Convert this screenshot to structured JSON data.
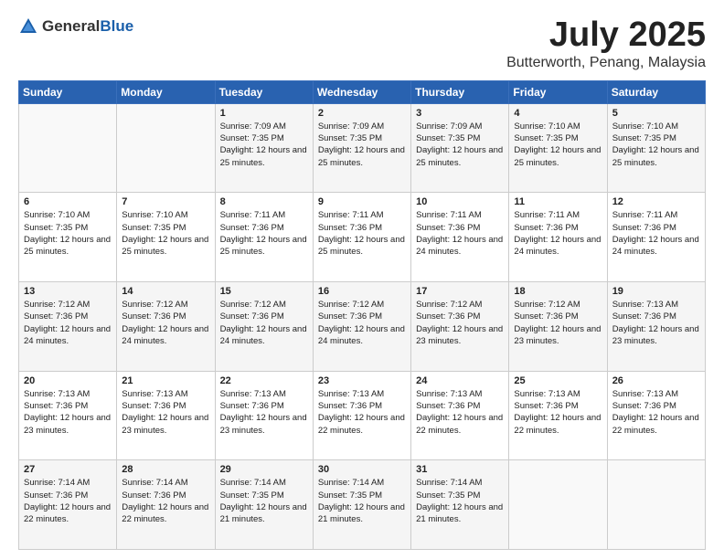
{
  "logo": {
    "general": "General",
    "blue": "Blue"
  },
  "title": {
    "month": "July 2025",
    "location": "Butterworth, Penang, Malaysia"
  },
  "weekdays": [
    "Sunday",
    "Monday",
    "Tuesday",
    "Wednesday",
    "Thursday",
    "Friday",
    "Saturday"
  ],
  "weeks": [
    [
      {
        "day": "",
        "info": ""
      },
      {
        "day": "",
        "info": ""
      },
      {
        "day": "1",
        "info": "Sunrise: 7:09 AM\nSunset: 7:35 PM\nDaylight: 12 hours and 25 minutes."
      },
      {
        "day": "2",
        "info": "Sunrise: 7:09 AM\nSunset: 7:35 PM\nDaylight: 12 hours and 25 minutes."
      },
      {
        "day": "3",
        "info": "Sunrise: 7:09 AM\nSunset: 7:35 PM\nDaylight: 12 hours and 25 minutes."
      },
      {
        "day": "4",
        "info": "Sunrise: 7:10 AM\nSunset: 7:35 PM\nDaylight: 12 hours and 25 minutes."
      },
      {
        "day": "5",
        "info": "Sunrise: 7:10 AM\nSunset: 7:35 PM\nDaylight: 12 hours and 25 minutes."
      }
    ],
    [
      {
        "day": "6",
        "info": "Sunrise: 7:10 AM\nSunset: 7:35 PM\nDaylight: 12 hours and 25 minutes."
      },
      {
        "day": "7",
        "info": "Sunrise: 7:10 AM\nSunset: 7:35 PM\nDaylight: 12 hours and 25 minutes."
      },
      {
        "day": "8",
        "info": "Sunrise: 7:11 AM\nSunset: 7:36 PM\nDaylight: 12 hours and 25 minutes."
      },
      {
        "day": "9",
        "info": "Sunrise: 7:11 AM\nSunset: 7:36 PM\nDaylight: 12 hours and 25 minutes."
      },
      {
        "day": "10",
        "info": "Sunrise: 7:11 AM\nSunset: 7:36 PM\nDaylight: 12 hours and 24 minutes."
      },
      {
        "day": "11",
        "info": "Sunrise: 7:11 AM\nSunset: 7:36 PM\nDaylight: 12 hours and 24 minutes."
      },
      {
        "day": "12",
        "info": "Sunrise: 7:11 AM\nSunset: 7:36 PM\nDaylight: 12 hours and 24 minutes."
      }
    ],
    [
      {
        "day": "13",
        "info": "Sunrise: 7:12 AM\nSunset: 7:36 PM\nDaylight: 12 hours and 24 minutes."
      },
      {
        "day": "14",
        "info": "Sunrise: 7:12 AM\nSunset: 7:36 PM\nDaylight: 12 hours and 24 minutes."
      },
      {
        "day": "15",
        "info": "Sunrise: 7:12 AM\nSunset: 7:36 PM\nDaylight: 12 hours and 24 minutes."
      },
      {
        "day": "16",
        "info": "Sunrise: 7:12 AM\nSunset: 7:36 PM\nDaylight: 12 hours and 24 minutes."
      },
      {
        "day": "17",
        "info": "Sunrise: 7:12 AM\nSunset: 7:36 PM\nDaylight: 12 hours and 23 minutes."
      },
      {
        "day": "18",
        "info": "Sunrise: 7:12 AM\nSunset: 7:36 PM\nDaylight: 12 hours and 23 minutes."
      },
      {
        "day": "19",
        "info": "Sunrise: 7:13 AM\nSunset: 7:36 PM\nDaylight: 12 hours and 23 minutes."
      }
    ],
    [
      {
        "day": "20",
        "info": "Sunrise: 7:13 AM\nSunset: 7:36 PM\nDaylight: 12 hours and 23 minutes."
      },
      {
        "day": "21",
        "info": "Sunrise: 7:13 AM\nSunset: 7:36 PM\nDaylight: 12 hours and 23 minutes."
      },
      {
        "day": "22",
        "info": "Sunrise: 7:13 AM\nSunset: 7:36 PM\nDaylight: 12 hours and 23 minutes."
      },
      {
        "day": "23",
        "info": "Sunrise: 7:13 AM\nSunset: 7:36 PM\nDaylight: 12 hours and 22 minutes."
      },
      {
        "day": "24",
        "info": "Sunrise: 7:13 AM\nSunset: 7:36 PM\nDaylight: 12 hours and 22 minutes."
      },
      {
        "day": "25",
        "info": "Sunrise: 7:13 AM\nSunset: 7:36 PM\nDaylight: 12 hours and 22 minutes."
      },
      {
        "day": "26",
        "info": "Sunrise: 7:13 AM\nSunset: 7:36 PM\nDaylight: 12 hours and 22 minutes."
      }
    ],
    [
      {
        "day": "27",
        "info": "Sunrise: 7:14 AM\nSunset: 7:36 PM\nDaylight: 12 hours and 22 minutes."
      },
      {
        "day": "28",
        "info": "Sunrise: 7:14 AM\nSunset: 7:36 PM\nDaylight: 12 hours and 22 minutes."
      },
      {
        "day": "29",
        "info": "Sunrise: 7:14 AM\nSunset: 7:35 PM\nDaylight: 12 hours and 21 minutes."
      },
      {
        "day": "30",
        "info": "Sunrise: 7:14 AM\nSunset: 7:35 PM\nDaylight: 12 hours and 21 minutes."
      },
      {
        "day": "31",
        "info": "Sunrise: 7:14 AM\nSunset: 7:35 PM\nDaylight: 12 hours and 21 minutes."
      },
      {
        "day": "",
        "info": ""
      },
      {
        "day": "",
        "info": ""
      }
    ]
  ]
}
